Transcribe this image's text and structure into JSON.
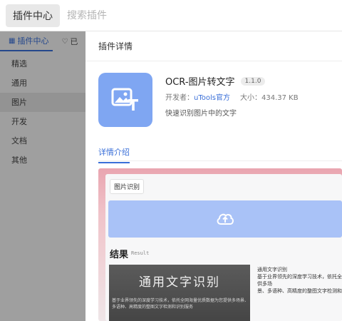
{
  "topbar": {
    "tag_label": "插件中心",
    "search_placeholder": "搜索插件"
  },
  "sidebar": {
    "tabs": [
      {
        "label": "插件中心",
        "icon": "grid-icon"
      },
      {
        "label": "已",
        "icon": "heart-icon"
      }
    ],
    "items": [
      {
        "label": "精选"
      },
      {
        "label": "通用"
      },
      {
        "label": "图片"
      },
      {
        "label": "开发"
      },
      {
        "label": "文档"
      },
      {
        "label": "其他"
      }
    ],
    "active_index": 2
  },
  "panel": {
    "title": "插件详情",
    "plugin": {
      "name": "OCR-图片转文字",
      "version": "1.1.0",
      "developer_label": "开发者：",
      "developer": "uTools官方",
      "size": "大小：434.37 KB",
      "description": "快速识别图片中的文字"
    },
    "tab_label": "详情介绍",
    "preview": {
      "card_title": "图片识别",
      "result_label": "结果",
      "result_sub": "Result",
      "sample_big": "通用文字识别",
      "sample_small": "基于业界领先的深度学习技术，依托全网海量优质数据为您提供多场景、多语种、高精度的整图文字检测和识别服务",
      "result_text": "通用文字识别\n基于业界领先的深度学习技术，依托全\n供多场\n景、多语种、高精度的整图文字检测和"
    }
  },
  "colors": {
    "accent": "#3a6fd8",
    "icon_bg": "#7fa6f2",
    "upload_bg": "#a9c2f7"
  }
}
